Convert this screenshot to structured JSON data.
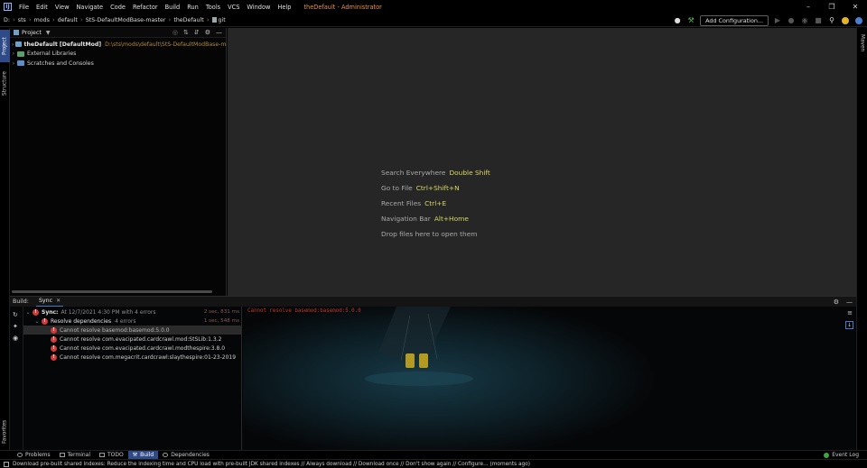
{
  "menubar": {
    "logo": "IJ",
    "items": [
      "File",
      "Edit",
      "View",
      "Navigate",
      "Code",
      "Refactor",
      "Build",
      "Run",
      "Tools",
      "VCS",
      "Window",
      "Help"
    ],
    "window_title": "theDefault - Administrator"
  },
  "breadcrumbs": [
    "D:",
    "sts",
    "mods",
    "default",
    "StS-DefaultModBase-master",
    "theDefault",
    "git"
  ],
  "toolbar": {
    "add_configuration_label": "Add Configuration..."
  },
  "left_stripe": {
    "project_tab": "Project",
    "structure_tab": "Structure",
    "favorites_tab": "Favorites"
  },
  "right_stripe": {
    "maven_tab": "Maven"
  },
  "project_panel": {
    "title": "Project",
    "tree": [
      {
        "label": "theDefault [DefaultMod]",
        "path": "D:\\sts\\mods\\default\\StS-DefaultModBase-master\\theDe"
      },
      {
        "label": "External Libraries"
      },
      {
        "label": "Scratches and Consoles"
      }
    ]
  },
  "editor_hints": [
    {
      "text": "Search Everywhere",
      "shortcut": "Double Shift"
    },
    {
      "text": "Go to File",
      "shortcut": "Ctrl+Shift+N"
    },
    {
      "text": "Recent Files",
      "shortcut": "Ctrl+E"
    },
    {
      "text": "Navigation Bar",
      "shortcut": "Alt+Home"
    },
    {
      "text": "Drop files here to open them",
      "shortcut": ""
    }
  ],
  "build": {
    "label": "Build:",
    "tab": "Sync",
    "tree": {
      "sync": {
        "prefix": "Sync:",
        "text": "At 12/7/2021 4:30 PM with 4 errors",
        "time": "2 sec, 831 ms"
      },
      "resolve": {
        "label": "Resolve dependencies",
        "count": "4 errors",
        "time": "1 sec, 548 ms"
      },
      "errors": [
        "Cannot resolve basemod:basemod:5.0.0",
        "Cannot resolve com.evacipated.cardcrawl.mod:StSLib:1.3.2",
        "Cannot resolve com.evacipated.cardcrawl.modthespire:3.8.0",
        "Cannot resolve com.megacrit.cardcrawl:slaythespire:01-23-2019"
      ]
    },
    "console_text": "Cannot resolve basemod:basemod:5.0.0"
  },
  "bottom_tools": [
    {
      "label": "Problems",
      "active": false
    },
    {
      "label": "Terminal",
      "active": false
    },
    {
      "label": "TODO",
      "active": false
    },
    {
      "label": "Build",
      "active": true
    },
    {
      "label": "Dependencies",
      "active": false
    }
  ],
  "event_log": "Event Log",
  "status_text": "Download pre-built shared indexes: Reduce the indexing time and CPU load with pre-built JDK shared indexes // Always download // Download once // Don't show again // Configure... (moments ago)",
  "colors": {
    "accent": "#2f4a88",
    "error": "#d03a3a",
    "shortcut": "#d8d862",
    "title": "#e8923a"
  }
}
